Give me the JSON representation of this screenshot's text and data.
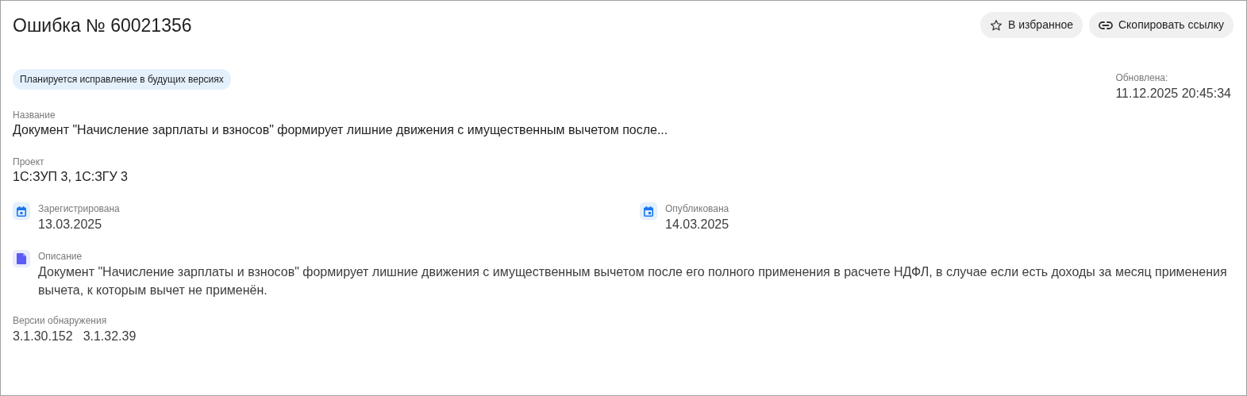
{
  "title": "Ошибка № 60021356",
  "actions": [
    {
      "kind": "favorite",
      "label": "В избранное"
    },
    {
      "kind": "link",
      "label": "Скопировать ссылку"
    }
  ],
  "status_badge": "Планируется исправление в будущих версиях",
  "updated": {
    "label": "Обновлена:",
    "value": "11.12.2025 20:45:34"
  },
  "name": {
    "label": "Название",
    "value": "Документ \"Начисление зарплаты и взносов\" формирует лишние движения с имущественным вычетом после..."
  },
  "project": {
    "label": "Проект",
    "value": "1С:ЗУП 3, 1С:ЗГУ 3"
  },
  "dates": [
    {
      "label": "Зарегистрирована",
      "value": "13.03.2025"
    },
    {
      "label": "Опубликована",
      "value": "14.03.2025"
    }
  ],
  "description": {
    "label": "Описание",
    "value": "Документ \"Начисление зарплаты и взносов\" формирует лишние движения с имущественным вычетом после его полного применения в расчете НДФЛ, в случае если есть доходы за месяц применения вычета, к которым вычет не применён."
  },
  "versions": {
    "label": "Версии обнаружения",
    "values": [
      "3.1.30.152",
      "3.1.32.39"
    ]
  }
}
